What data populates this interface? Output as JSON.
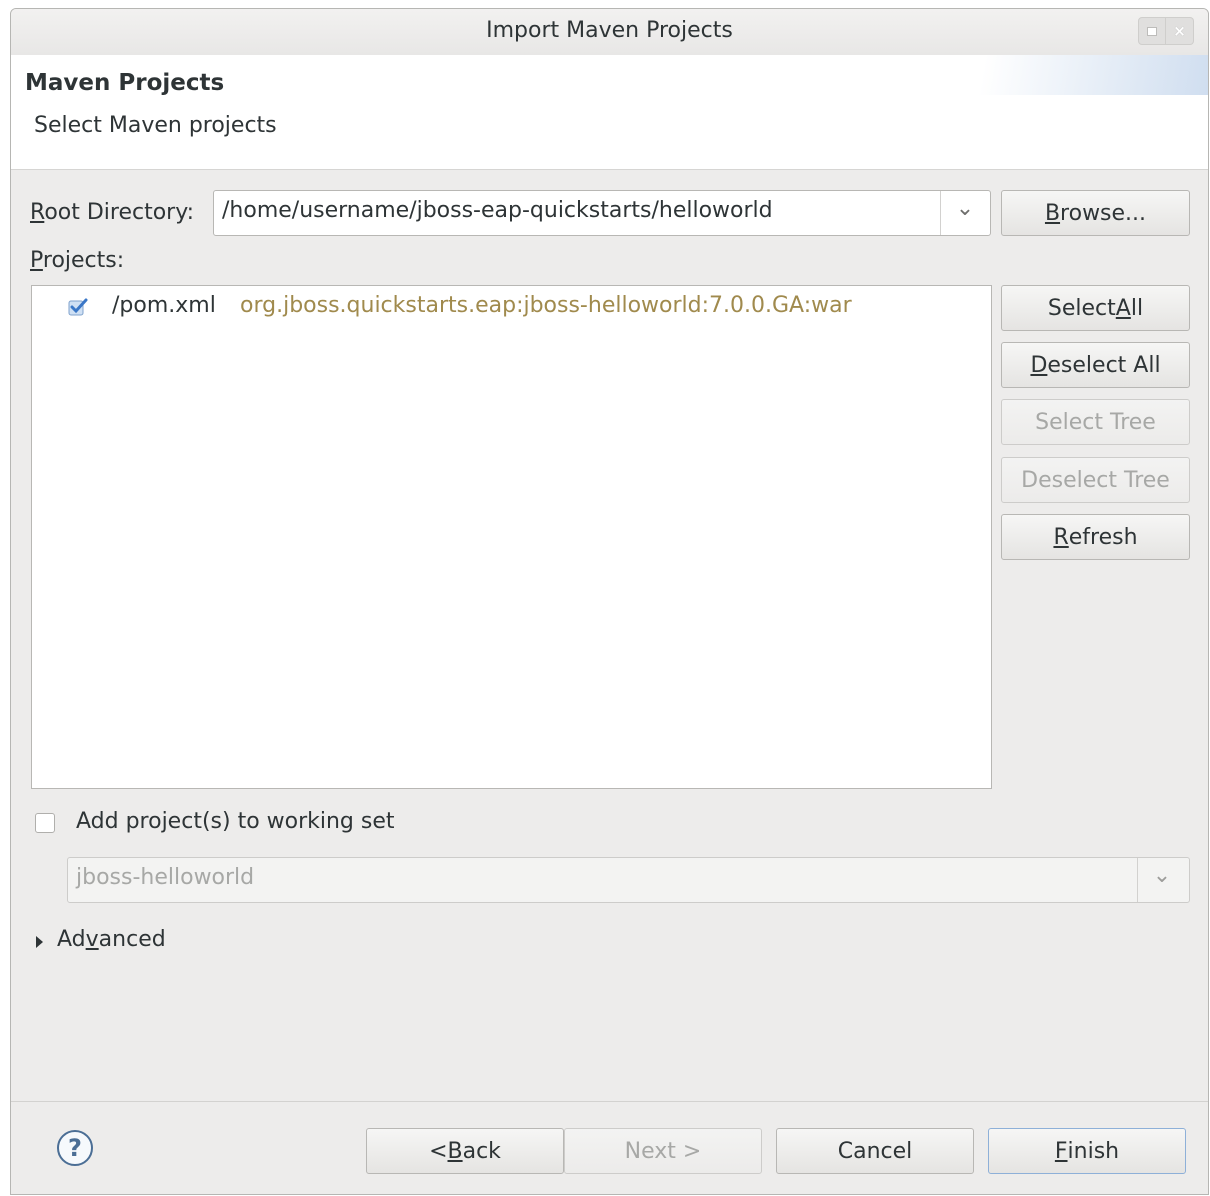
{
  "window": {
    "title": "Import Maven Projects"
  },
  "header": {
    "title": "Maven Projects",
    "subtitle": "Select Maven projects"
  },
  "root_directory": {
    "label_accel": "R",
    "label_rest": "oot Directory:",
    "value": "/home/username/jboss-eap-quickstarts/helloworld"
  },
  "buttons": {
    "browse": {
      "accel": "B",
      "rest": "rowse..."
    },
    "select_all": {
      "pre": "Select ",
      "accel": "A",
      "rest": "ll"
    },
    "deselect_all": {
      "accel": "D",
      "rest": "eselect All"
    },
    "select_tree": "Select Tree",
    "deselect_tree": "Deselect Tree",
    "refresh": {
      "accel": "R",
      "rest": "efresh"
    }
  },
  "projects": {
    "label_accel": "P",
    "label_rest": "rojects:",
    "items": [
      {
        "path": "/pom.xml",
        "coordinates": "org.jboss.quickstarts.eap:jboss-helloworld:7.0.0.GA:war",
        "checked": true
      }
    ]
  },
  "working_set": {
    "checkbox_label": "Add project(s) to working set",
    "checked": false,
    "value": "jboss-helloworld"
  },
  "advanced": {
    "pre": "Ad",
    "accel": "v",
    "rest": "anced"
  },
  "footer": {
    "back": {
      "pre": "< ",
      "accel": "B",
      "rest": "ack"
    },
    "next": "Next >",
    "cancel": "Cancel",
    "finish": {
      "accel": "F",
      "rest": "inish"
    }
  },
  "colors": {
    "coordinates_text": "#a08a4d",
    "check_blue": "#3a77c7"
  },
  "icons": [
    "maximize-icon",
    "close-icon",
    "chevron-down-icon",
    "checkbox-checked-icon",
    "expand-triangle-icon",
    "help-icon"
  ]
}
